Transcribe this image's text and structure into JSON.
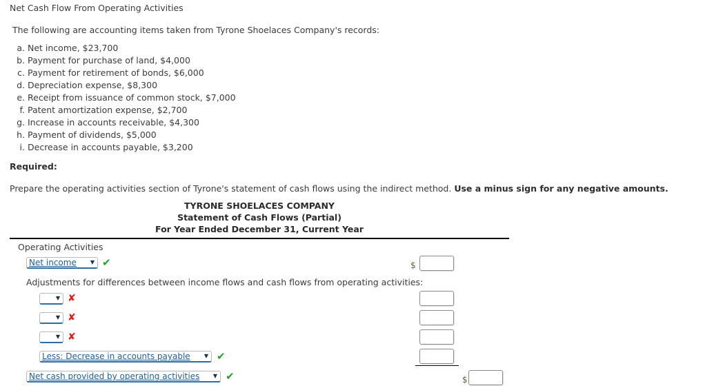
{
  "exercise": {
    "title": "Net Cash Flow From Operating Activities",
    "intro": "The following are accounting items taken from Tyrone Shoelaces Company's records:",
    "items": [
      {
        "letter": "a.",
        "text": "Net income, $23,700"
      },
      {
        "letter": "b.",
        "text": "Payment for purchase of land, $4,000"
      },
      {
        "letter": "c.",
        "text": "Payment for retirement of bonds, $6,000"
      },
      {
        "letter": "d.",
        "text": "Depreciation expense, $8,300"
      },
      {
        "letter": "e.",
        "text": "Receipt from issuance of common stock, $7,000"
      },
      {
        "letter": "f.",
        "text": "Patent amortization expense, $2,700"
      },
      {
        "letter": "g.",
        "text": "Increase in accounts receivable, $4,300"
      },
      {
        "letter": "h.",
        "text": "Payment of dividends, $5,000"
      },
      {
        "letter": "i.",
        "text": "Decrease in accounts payable, $3,200"
      }
    ],
    "required_label": "Required:",
    "instruction_plain": "Prepare the operating activities section of Tyrone's statement of cash flows using the indirect method. ",
    "instruction_bold": "Use a minus sign for any negative amounts."
  },
  "statement": {
    "company": "TYRONE SHOELACES COMPANY",
    "title": "Statement of Cash Flows (Partial)",
    "period": "For Year Ended December 31, Current Year",
    "section_label": "Operating Activities",
    "adjustments_label": "Adjustments for differences between income flows and cash flows from operating activities:",
    "rows": [
      {
        "id": "net-income",
        "value": "Net income",
        "arrow": "▼",
        "mark": "✔",
        "mark_state": "ok"
      },
      {
        "id": "adjustment-1",
        "value": "",
        "arrow": "▼",
        "mark": "✘",
        "mark_state": "bad"
      },
      {
        "id": "adjustment-2",
        "value": "",
        "arrow": "▼",
        "mark": "✘",
        "mark_state": "bad"
      },
      {
        "id": "adjustment-3",
        "value": "",
        "arrow": "▼",
        "mark": "✘",
        "mark_state": "bad"
      },
      {
        "id": "adjustment-4",
        "value": "Less: Decrease in accounts payable",
        "arrow": "▼",
        "mark": "✔",
        "mark_state": "ok"
      },
      {
        "id": "net-cash",
        "value": "Net cash provided by operating activities",
        "arrow": "▼",
        "mark": "✔",
        "mark_state": "ok"
      }
    ],
    "amounts": [
      {
        "id": "amount-net-income",
        "value": "",
        "currency": "$"
      },
      {
        "id": "amount-adjustment-1",
        "value": "",
        "currency": ""
      },
      {
        "id": "amount-adjustment-2",
        "value": "",
        "currency": ""
      },
      {
        "id": "amount-adjustment-3",
        "value": "",
        "currency": ""
      },
      {
        "id": "amount-adjustment-4",
        "value": "",
        "currency": ""
      },
      {
        "id": "amount-net-cash",
        "value": "",
        "currency": "$"
      }
    ]
  },
  "marks": {
    "correct_glyph": "✔",
    "incorrect_glyph": "✘"
  },
  "colors": {
    "link_blue": "#1f5fa0",
    "underline_blue": "#2e6da4",
    "correct_green": "#23a026",
    "incorrect_red": "#e01b1b",
    "text": "#3b3b3b"
  }
}
